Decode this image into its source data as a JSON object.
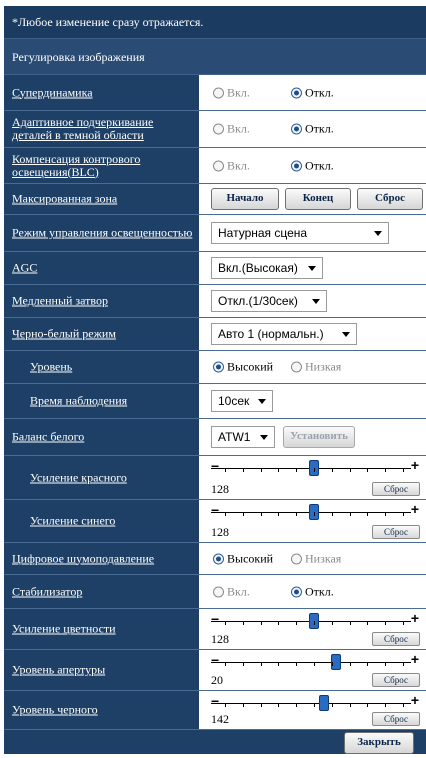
{
  "notice": "*Любое изменение сразу отражается.",
  "section_title": "Регулировка изображения",
  "radio_on": "Вкл.",
  "radio_off": "Откл.",
  "level_high": "Высокий",
  "level_low": "Низкая",
  "reset_label": "Сброс",
  "rows": {
    "superdynamic": {
      "label": "Супердинамика",
      "selected": "Откл."
    },
    "adaptive": {
      "label": "Адаптивное подчеркивание деталей в темной области",
      "selected": "Откл."
    },
    "blc": {
      "label": "Компенсация контрового освещения(BLC)",
      "selected": "Откл."
    },
    "mask": {
      "label": "Максированная зона",
      "start": "Начало",
      "end": "Конец",
      "reset": "Сброс"
    },
    "light_mode": {
      "label": "Режим управления освещенностью",
      "value": "Натурная сцена"
    },
    "agc": {
      "label": "AGC",
      "value": "Вкл.(Высокая)"
    },
    "shutter": {
      "label": "Медленный затвор",
      "value": "Откл.(1/30сек)"
    },
    "bw_mode": {
      "label": "Черно-белый режим",
      "value": "Авто 1 (нормальн.)"
    },
    "level": {
      "label": "Уровень",
      "selected": "Высокий"
    },
    "watch_time": {
      "label": "Время наблюдения",
      "value": "10сек"
    },
    "white_balance": {
      "label": "Баланс белого",
      "value": "ATW1",
      "set_button": "Установить"
    },
    "red_gain": {
      "label": "Усиление красного",
      "value": "128",
      "fraction": 0.5
    },
    "blue_gain": {
      "label": "Усиление синего",
      "value": "128",
      "fraction": 0.5
    },
    "dnr": {
      "label": "Цифровое шумоподавление",
      "selected": "Высокий"
    },
    "stabilizer": {
      "label": "Стабилизатор",
      "selected": "Откл."
    },
    "chroma": {
      "label": "Усиление цветности",
      "value": "128",
      "fraction": 0.5
    },
    "aperture": {
      "label": "Уровень апертуры",
      "value": "20",
      "fraction": 0.625
    },
    "black": {
      "label": "Уровень черного",
      "value": "142",
      "fraction": 0.555
    }
  },
  "close_button": "Закрыть"
}
